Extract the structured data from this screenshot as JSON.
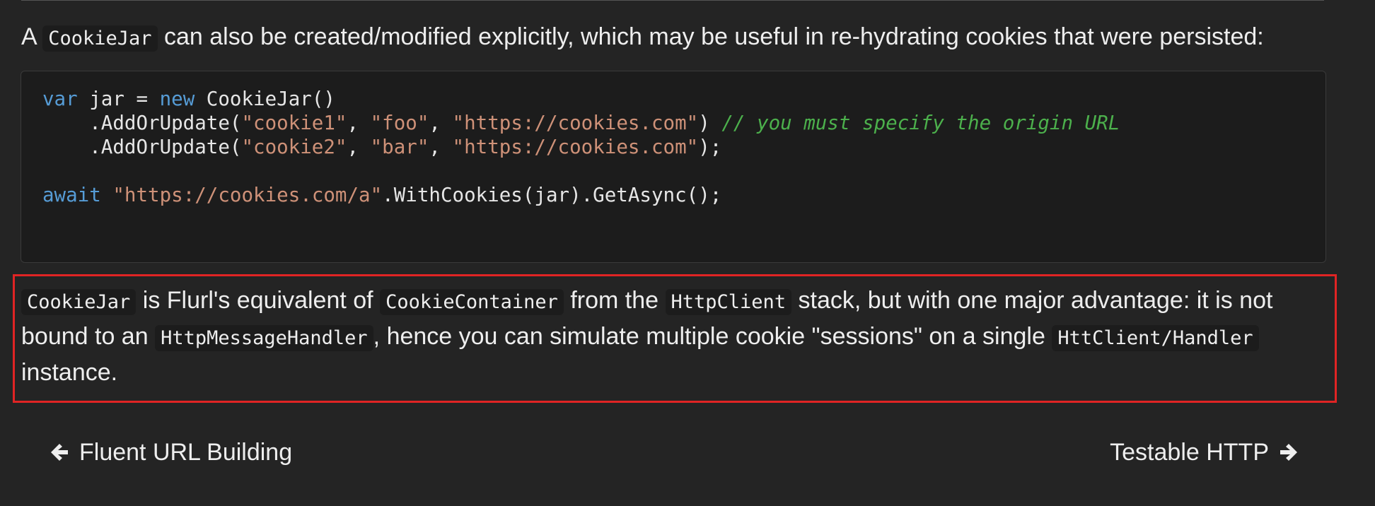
{
  "intro": {
    "prefix": "A ",
    "code": "CookieJar",
    "suffix": " can also be created/modified explicitly, which may be useful in re-hydrating cookies that were persisted:"
  },
  "code_block": {
    "line1": {
      "kw": "var",
      "t1": " jar = ",
      "kw2": "new",
      "t2": " CookieJar()"
    },
    "line2": {
      "t1": "    .AddOrUpdate(",
      "s1": "\"cookie1\"",
      "t2": ", ",
      "s2": "\"foo\"",
      "t3": ", ",
      "s3": "\"https://cookies.com\"",
      "t4": ") ",
      "comment": "// you must specify the origin URL"
    },
    "line3": {
      "t1": "    .AddOrUpdate(",
      "s1": "\"cookie2\"",
      "t2": ", ",
      "s2": "\"bar\"",
      "t3": ", ",
      "s3": "\"https://cookies.com\"",
      "t4": ");"
    },
    "line5": {
      "kw": "await",
      "t1": " ",
      "s1": "\"https://cookies.com/a\"",
      "t2": ".WithCookies(jar).GetAsync();"
    }
  },
  "callout": {
    "line1": {
      "code1": "CookieJar",
      "t1": " is Flurl's equivalent of ",
      "code2": "CookieContainer",
      "t2": " from the ",
      "code3": "HttpClient",
      "t3": " stack, but with one major advantage: it is not"
    },
    "line2": {
      "t1": "bound to an ",
      "code1": "HttpMessageHandler",
      "t2": ", hence you can simulate multiple cookie \"sessions\" on a single ",
      "code2": "HttClient/Handler"
    },
    "line3": {
      "t1": "instance."
    }
  },
  "nav": {
    "prev_label": "Fluent URL Building",
    "prev_icon": "arrow-left-icon",
    "next_label": "Testable HTTP",
    "next_icon": "arrow-right-icon"
  },
  "colors": {
    "background": "#242424",
    "code_background": "#1c1c1c",
    "keyword": "#569cd6",
    "string": "#ce9178",
    "comment": "#4cb04c",
    "highlight_border": "#e02424"
  }
}
